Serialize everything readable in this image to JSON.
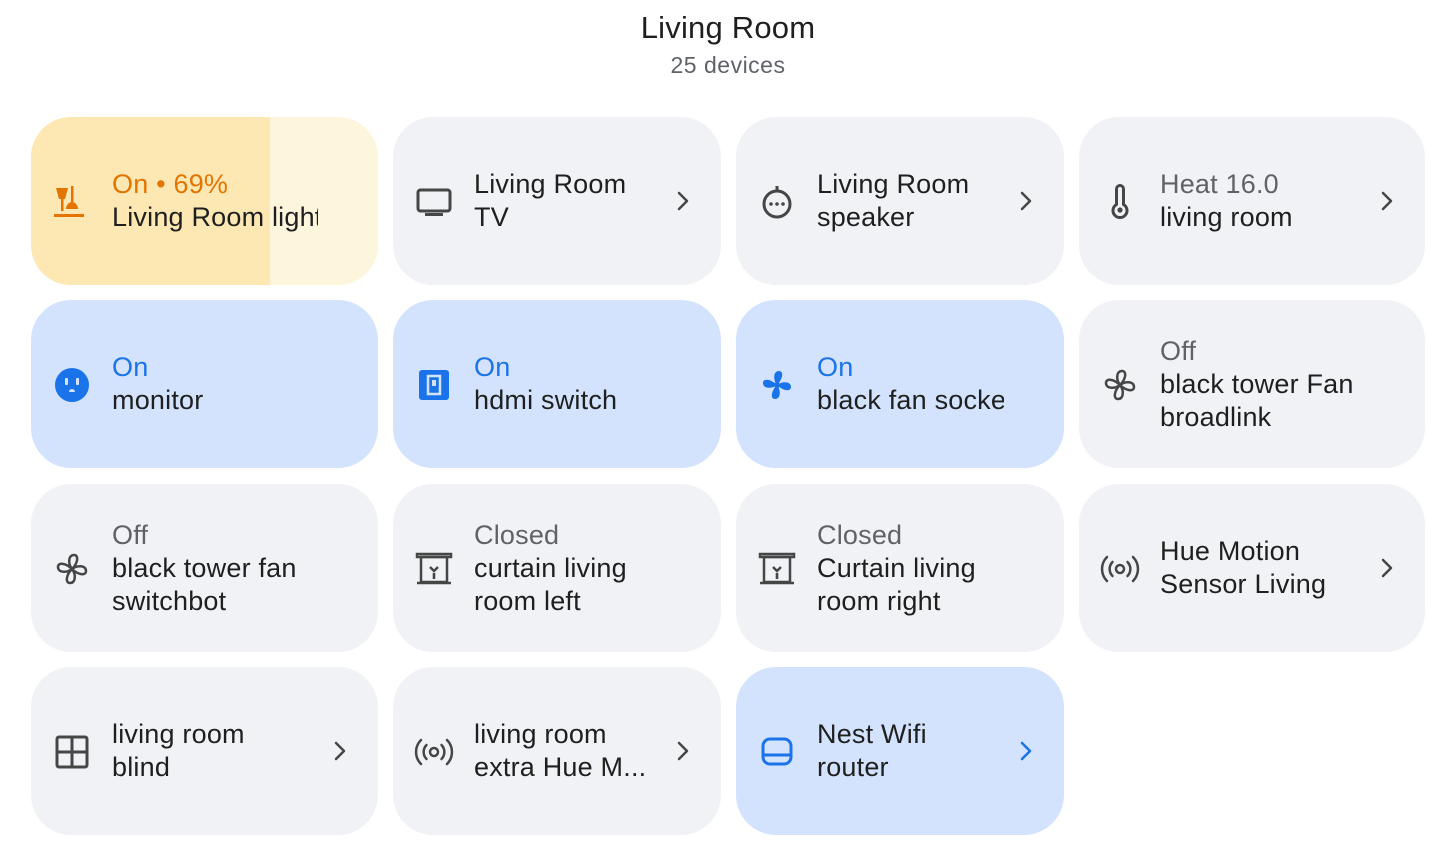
{
  "room": {
    "title": "Living Room",
    "subtitle": "25 devices"
  },
  "colors": {
    "accent": "#1a73e8",
    "light_accent": "#e37400",
    "tile": "#f0f2f5",
    "tile_active": "#d3e3fd",
    "tile_light": "#fdf5dc",
    "light_fill": "#fde8b4"
  },
  "tiles": [
    {
      "icon": "lamp-icon",
      "state": "On • 69%",
      "name_lines": [
        "Living Room lights"
      ],
      "brightness_pct": 69
    },
    {
      "icon": "tv-icon",
      "name_lines": [
        "Living Room",
        "TV"
      ]
    },
    {
      "icon": "speaker-icon",
      "name_lines": [
        "Living Room",
        "speaker"
      ]
    },
    {
      "icon": "thermometer-icon",
      "state": "Heat 16.0",
      "name_lines": [
        "living room"
      ]
    },
    {
      "icon": "outlet-icon",
      "state": "On",
      "name_lines": [
        "monitor"
      ]
    },
    {
      "icon": "switch-icon",
      "state": "On",
      "name_lines": [
        "hdmi switch"
      ]
    },
    {
      "icon": "fan-icon",
      "state": "On",
      "name_lines": [
        "black fan socket"
      ]
    },
    {
      "icon": "fan-icon",
      "state": "Off",
      "name_lines": [
        "black tower Fan",
        "broadlink"
      ]
    },
    {
      "icon": "fan-icon",
      "state": "Off",
      "name_lines": [
        "black tower fan",
        "switchbot"
      ]
    },
    {
      "icon": "curtain-icon",
      "state": "Closed",
      "name_lines": [
        "curtain living",
        "room left"
      ]
    },
    {
      "icon": "curtain-icon",
      "state": "Closed",
      "name_lines": [
        "Curtain living",
        "room right"
      ]
    },
    {
      "icon": "motion-sensor-icon",
      "name_lines": [
        "Hue Motion",
        "Sensor Living"
      ]
    },
    {
      "icon": "blind-icon",
      "name_lines": [
        "living room",
        "blind"
      ]
    },
    {
      "icon": "motion-sensor-icon",
      "name_lines": [
        "living room",
        "extra Hue M..."
      ]
    },
    {
      "icon": "router-icon",
      "name_lines": [
        "Nest Wifi",
        "router"
      ]
    }
  ]
}
